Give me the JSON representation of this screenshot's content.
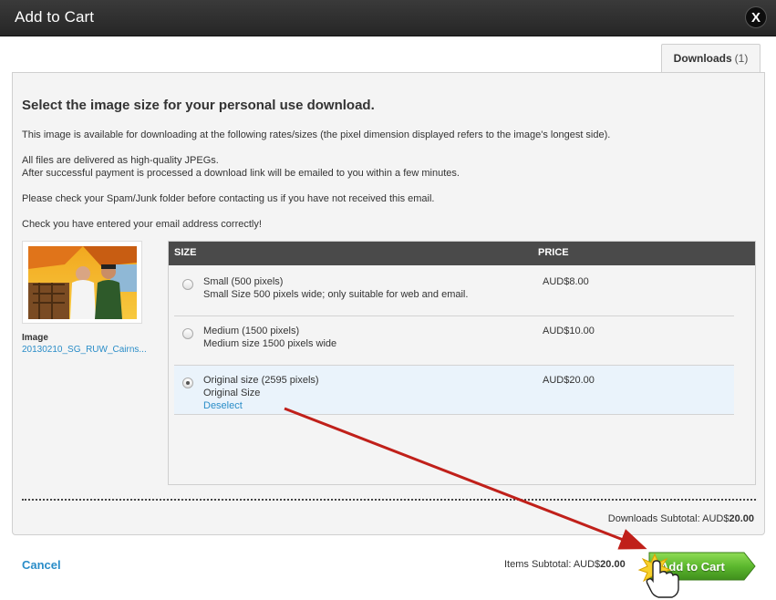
{
  "dialog": {
    "title": "Add to Cart",
    "close_label": "X"
  },
  "tab": {
    "label": "Downloads",
    "count": "(1)"
  },
  "heading": "Select the image size for your personal use download.",
  "info": {
    "line1": "This image is available for downloading at the following rates/sizes (the pixel dimension displayed refers to the image's longest side).",
    "line2": "All files are delivered as high-quality JPEGs.",
    "line3": "After successful payment is processed a download link will be emailed to you within a few minutes.",
    "line4": "Please check your Spam/Junk folder before contacting us if you have not received this email.",
    "line5": "Check you have entered your email address correctly!"
  },
  "image": {
    "label": "Image",
    "filename": "20130210_SG_RUW_Cairns..."
  },
  "table": {
    "col_size": "SIZE",
    "col_price": "PRICE",
    "rows": [
      {
        "name": "Small (500 pixels)",
        "desc": "Small Size 500 pixels wide; only suitable for web and email.",
        "price": "AUD$8.00",
        "selected": false
      },
      {
        "name": "Medium (1500 pixels)",
        "desc": "Medium size 1500 pixels wide",
        "price": "AUD$10.00",
        "selected": false
      },
      {
        "name": "Original size (2595 pixels)",
        "desc": "Original Size",
        "price": "AUD$20.00",
        "selected": true,
        "deselect": "Deselect"
      }
    ]
  },
  "downloads_subtotal": {
    "label": "Downloads Subtotal: AUD$",
    "amount": "20.00"
  },
  "footer": {
    "cancel": "Cancel",
    "items_subtotal_label": "Items Subtotal: AUD$",
    "items_subtotal_amount": "20.00",
    "add_button": "Add to Cart"
  },
  "colors": {
    "accent_green": "#5cb82e",
    "link_blue": "#2a8dc8",
    "annotation_red": "#c0201a",
    "header_dark": "#4a4a4a"
  }
}
